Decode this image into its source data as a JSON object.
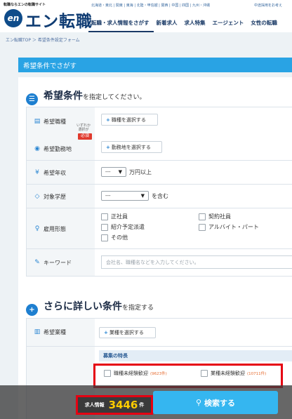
{
  "header": {
    "tagline": "転職ならエンの転職サイト",
    "logo_mark": "en",
    "logo_text": "エン転職",
    "regions": "北海道・東北 | 関東 | 東海 | 北陸・甲信越 | 関西 | 中国 | 四国 | 九州・沖縄",
    "right_link": "中途採用をお考え",
    "nav": [
      "転職・求人情報をさがす",
      "新着求人",
      "求人特集",
      "エージェント",
      "女性の転職"
    ]
  },
  "breadcrumb": "エン転職TOP ＞ 希望条件設定フォーム",
  "title_bar": "希望条件でさがす",
  "section1": {
    "icon": "list-icon",
    "big": "希望条件",
    "small": "を指定してください。",
    "rows": {
      "job_label": "希望職種",
      "location_label": "希望勤務地",
      "either_note": "いずれか\n選択が",
      "required_badge": "必須",
      "job_button": "職種を選択する",
      "location_button": "勤務地を選択する",
      "income_label": "希望年収",
      "income_value": "---",
      "income_unit": "万円以上",
      "edu_label": "対象学歴",
      "edu_value": "---",
      "edu_unit": "を含む",
      "emp_label": "雇用形態",
      "emp_options": [
        "正社員",
        "契約社員",
        "紹介予定派遣",
        "アルバイト・パート",
        "その他"
      ],
      "kw_label": "キーワード",
      "kw_placeholder": "会社名、職種名などを入力してください。"
    }
  },
  "section2": {
    "icon": "plus-icon",
    "big": "さらに詳しい条件",
    "small": "を指定する",
    "industry_label": "希望業種",
    "industry_button": "業種を選択する",
    "feature_head": "募集の特長",
    "features": [
      {
        "label": "職種未経験歓迎",
        "count": "(9623件)"
      },
      {
        "label": "業種未経験歓迎",
        "count": "(10711件)"
      }
    ]
  },
  "bottom": {
    "count_label": "求人情報",
    "count_value": "3446",
    "count_unit": "件",
    "search_label": "検索する"
  },
  "colors": {
    "brand_navy": "#0f3c73",
    "title_bar": "#29a3e4",
    "accent_blue": "#1e7fd0",
    "highlight_red": "#e50012",
    "count_yellow": "#ffcc00",
    "search_button": "#35b6f0"
  }
}
